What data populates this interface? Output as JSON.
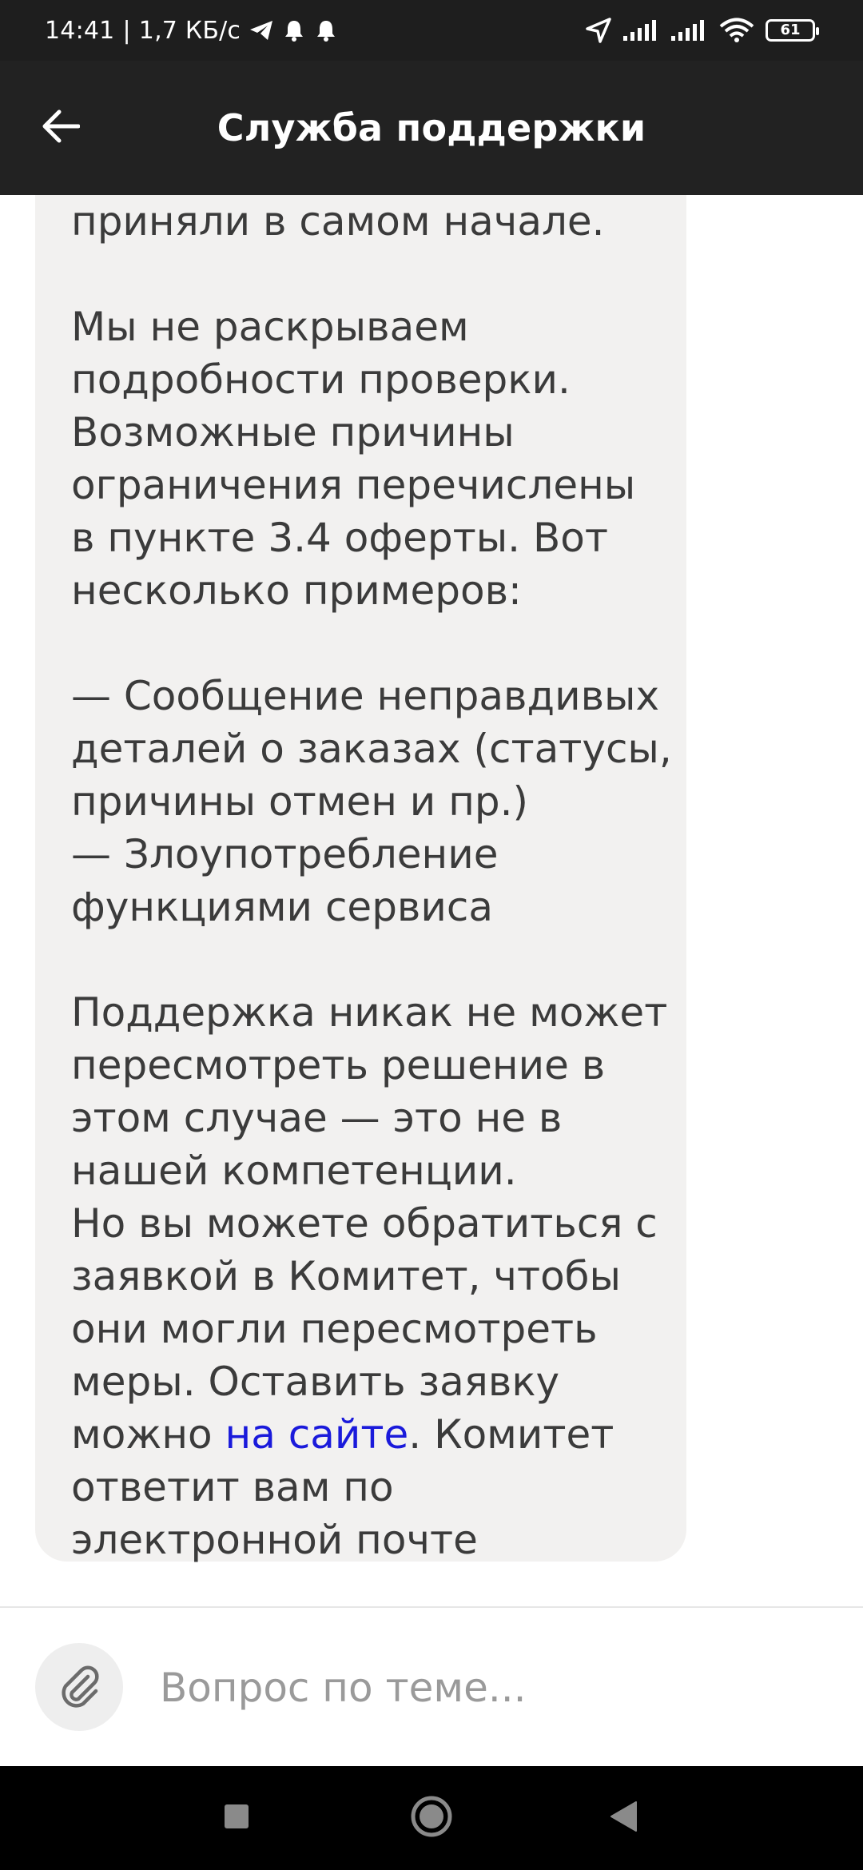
{
  "status_bar": {
    "time": "14:41",
    "separator": "|",
    "speed": "1,7 КБ/с",
    "battery": "61"
  },
  "header": {
    "title": "Служба поддержки"
  },
  "message": {
    "p0": "приняли в самом начале.",
    "p1": "Мы не раскрываем\nподробности проверки.\nВозможные причины\nограничения перечислены\nв пункте 3.4 оферты. Вот\nнесколько примеров:",
    "p2": "— Сообщение неправдивых\nдеталей о заказах (статусы,\nпричины отмен и пр.)\n— Злоупотребление\nфункциями сервиса",
    "p3": "Поддержка никак не может\nпересмотреть решение в\nэтом случае — это не в\nнашей компетенции.\nНо вы можете обратиться с\nзаявкой в Комитет, чтобы\nони могли пересмотреть\nмеры. Оставить заявку\nможно ",
    "link_text": "на сайте",
    "p3_after": ". Комитет\nответит вам по\nэлектронной почте",
    "link_color": "#1a1adb"
  },
  "input": {
    "placeholder": "Вопрос по теме..."
  },
  "colors": {
    "app_bar": "#222222",
    "bubble": "#f2f1f0",
    "text": "#3b3b3b"
  },
  "icons": {
    "back": "arrow-left-icon",
    "attach": "paperclip-icon",
    "nav_recents": "square-icon",
    "nav_home": "circle-icon",
    "nav_back": "triangle-icon"
  }
}
